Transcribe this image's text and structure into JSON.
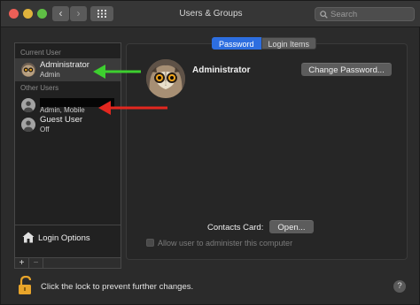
{
  "window": {
    "title": "Users & Groups"
  },
  "toolbar": {
    "back_glyph": "‹",
    "forward_glyph": "›",
    "search_placeholder": "Search"
  },
  "sidebar": {
    "current_user_label": "Current User",
    "other_users_label": "Other Users",
    "current_user": {
      "name": "Administrator",
      "role": "Admin",
      "avatar": "owl-avatar"
    },
    "other_users": [
      {
        "name": "",
        "role": "Admin, Mobile",
        "avatar": "generic-user-icon",
        "redacted": true
      },
      {
        "name": "Guest User",
        "role": "Off",
        "avatar": "generic-user-icon"
      }
    ],
    "login_options_label": "Login Options",
    "add_glyph": "+",
    "remove_glyph": "−"
  },
  "tabs": [
    {
      "label": "Password",
      "active": true
    },
    {
      "label": "Login Items",
      "active": false
    }
  ],
  "detail": {
    "user_name": "Administrator",
    "change_password_label": "Change Password...",
    "contacts_card_label": "Contacts Card:",
    "open_label": "Open...",
    "allow_admin_label": "Allow user to administer this computer",
    "allow_admin_checked": false,
    "allow_admin_enabled": false
  },
  "footer": {
    "lock_text": "Click the lock to prevent further changes.",
    "help_glyph": "?"
  },
  "annotations": {
    "green_arrow_color": "#3dcf2f",
    "red_arrow_color": "#e3271f"
  }
}
